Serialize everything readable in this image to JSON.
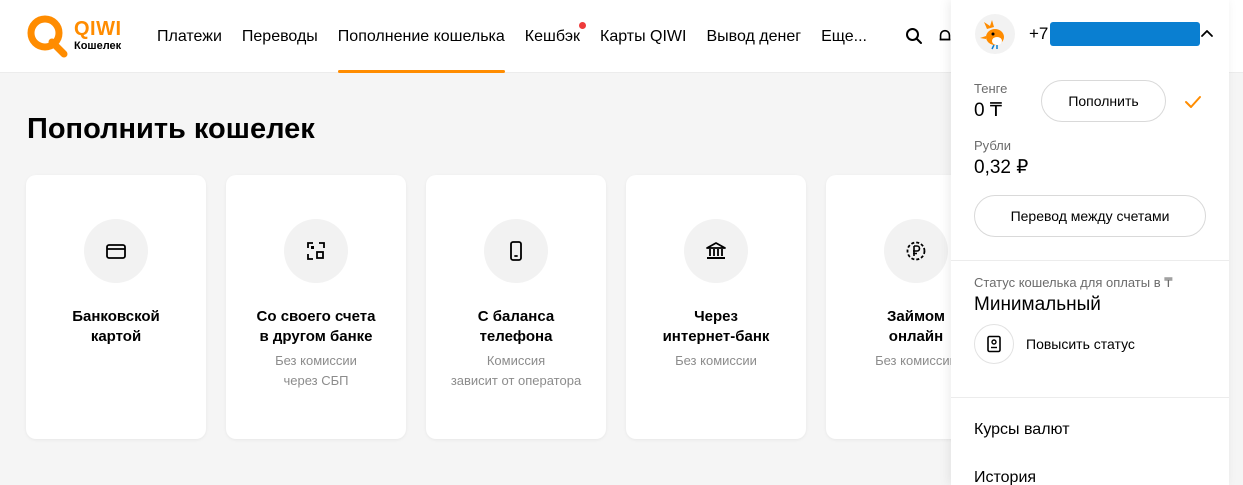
{
  "brand": {
    "name": "QIWI",
    "subtitle": "Кошелек",
    "accent": "#ff8c00"
  },
  "nav": {
    "items": [
      {
        "label": "Платежи"
      },
      {
        "label": "Переводы"
      },
      {
        "label": "Пополнение кошелька",
        "active": true
      },
      {
        "label": "Кешбэк",
        "badge_dot": true
      },
      {
        "label": "Карты QIWI"
      },
      {
        "label": "Вывод денег"
      },
      {
        "label": "Еще..."
      }
    ],
    "icons": [
      "search-icon",
      "bell-icon"
    ]
  },
  "main": {
    "title": "Пополнить кошелек",
    "cards": [
      {
        "icon": "bank-card-icon",
        "title_line1": "Банковской",
        "title_line2": "картой",
        "desc_line1": "",
        "desc_line2": ""
      },
      {
        "icon": "qr-code-icon",
        "title_line1": "Со своего счета",
        "title_line2": "в другом банке",
        "desc_line1": "Без комиссии",
        "desc_line2": "через СБП"
      },
      {
        "icon": "phone-icon",
        "title_line1": "С баланса",
        "title_line2": "телефона",
        "desc_line1": "Комиссия",
        "desc_line2": "зависит от оператора"
      },
      {
        "icon": "bank-building-icon",
        "title_line1": "Через",
        "title_line2": "интернет-банк",
        "desc_line1": "Без комиссии",
        "desc_line2": ""
      },
      {
        "icon": "ruble-coin-icon",
        "title_line1": "Займом",
        "title_line2": "онлайн",
        "desc_line1": "Без комиссии",
        "desc_line2": ""
      }
    ]
  },
  "account_panel": {
    "phone_prefix": "+7",
    "phone_masked_color": "#0a7fd1",
    "balances": [
      {
        "label": "Тенге",
        "value": "0 ₸"
      },
      {
        "label": "Рубли",
        "value": "0,32 ₽"
      }
    ],
    "topup_label": "Пополнить",
    "transfer_label": "Перевод между счетами",
    "status_label": "Статус кошелька для оплаты в ₸",
    "status_value": "Минимальный",
    "raise_status_label": "Повысить статус",
    "links": [
      {
        "label": "Курсы валют"
      },
      {
        "label": "История"
      }
    ]
  }
}
